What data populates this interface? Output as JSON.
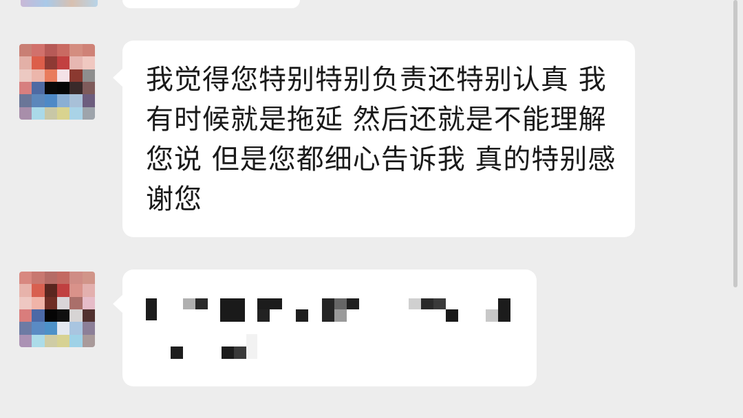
{
  "conversation": {
    "messages": [
      {
        "sender": "avatar-a",
        "text": "我觉得您特别特别负责还特别认真 我有时候就是拖延 然后还就是不能理解您说 但是您都细心告诉我 真的特别感谢您"
      },
      {
        "sender": "avatar-b",
        "text": ""
      }
    ]
  },
  "colors": {
    "background": "#ededed",
    "bubble": "#ffffff",
    "text": "#1a1a1a"
  }
}
